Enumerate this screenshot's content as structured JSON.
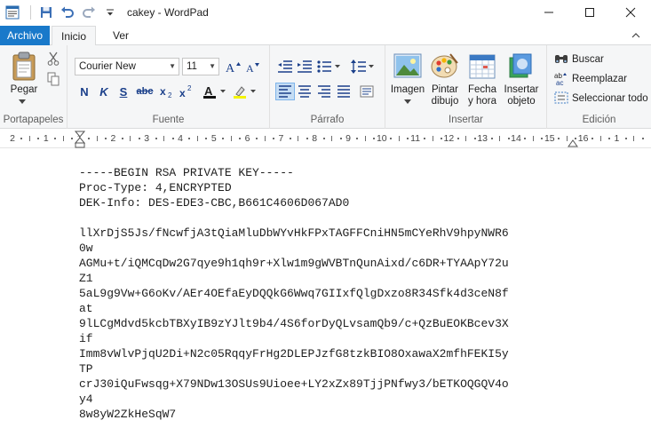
{
  "window": {
    "title": "cakey - WordPad"
  },
  "tabs": {
    "file": "Archivo",
    "home": "Inicio",
    "view": "Ver"
  },
  "ribbon": {
    "clipboard": {
      "paste": "Pegar",
      "label": "Portapapeles"
    },
    "font": {
      "family": "Courier New",
      "size": "11",
      "bold": "N",
      "italic": "K",
      "underline": "S",
      "strike": "abc",
      "label": "Fuente"
    },
    "paragraph": {
      "label": "Párrafo"
    },
    "insert": {
      "image": "Imagen",
      "paint_l1": "Pintar",
      "paint_l2": "dibujo",
      "date_l1": "Fecha",
      "date_l2": "y hora",
      "object_l1": "Insertar",
      "object_l2": "objeto",
      "label": "Insertar"
    },
    "edit": {
      "find": "Buscar",
      "replace": "Reemplazar",
      "select_all": "Seleccionar todo",
      "label": "Edición"
    }
  },
  "ruler": {
    "numbers": [
      "2",
      "1",
      "1",
      "2",
      "3",
      "4",
      "5",
      "6",
      "7",
      "8",
      "9",
      "10",
      "11",
      "12",
      "13",
      "14",
      "15",
      "16",
      "1"
    ]
  },
  "document": {
    "lines": [
      "-----BEGIN RSA PRIVATE KEY-----",
      "Proc-Type: 4,ENCRYPTED",
      "DEK-Info: DES-EDE3-CBC,B661C4606D067AD0",
      "",
      "llXrDjS5Js/fNcwfjA3tQiaMluDbWYvHkFPxTAGFFCniHN5mCYeRhV9hpyNWR6",
      "0w",
      "AGMu+t/iQMCqDw2G7qye9h1qh9r+Xlw1m9gWVBTnQunAixd/c6DR+TYAApY72u",
      "Z1",
      "5aL9g9Vw+G6oKv/AEr4OEfaEyDQQkG6Wwq7GIIxfQlgDxzo8R34Sfk4d3ceN8f",
      "at",
      "9lLCgMdvd5kcbTBXyIB9zYJlt9b4/4S6forDyQLvsamQb9/c+QzBuEOKBcev3X",
      "if",
      "Imm8vWlvPjqU2Di+N2c05RqqyFrHg2DLEPJzfG8tzkBIO8OxawaX2mfhFEKI5y",
      "TP",
      "crJ30iQuFwsqg+X79NDw13OSUs9Uioee+LY2xZx89TjjPNfwy3/bETKOQGQV4o",
      "y4",
      "8w8yW2ZkHeSqW7"
    ]
  }
}
